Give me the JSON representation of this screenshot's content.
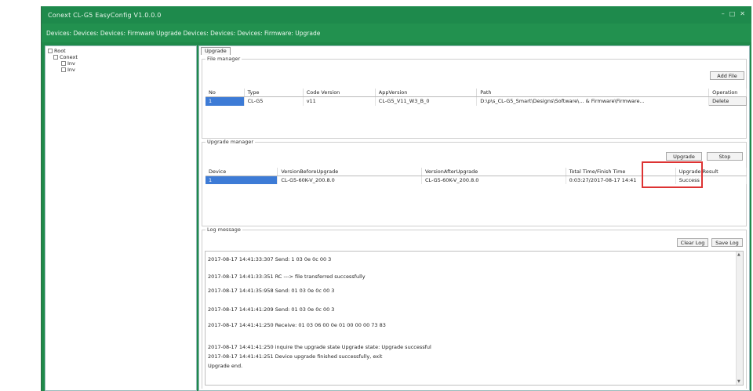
{
  "window": {
    "title": "Conext CL-G5 EasyConfig V1.0.0.0",
    "controls": [
      "–",
      "□",
      "✕"
    ]
  },
  "devices_bar": "Devices: Devices: Devices: Firmware Upgrade Devices: Devices: Devices: Firmware: Upgrade",
  "tree": {
    "root": "Root",
    "child": "Conext",
    "leaves": [
      "Inv",
      "Inv"
    ]
  },
  "tab": "Upgrade",
  "file_manager": {
    "title": "File manager",
    "add_button": "Add File",
    "columns": [
      "No",
      "Type",
      "Code Version",
      "AppVersion",
      "Path",
      "Operation"
    ],
    "rows": [
      {
        "no": "1",
        "type": "CL-G5",
        "code": "v11",
        "app": "CL-G5_V11_W3_B_0",
        "path": "D:\\p\\s_CL-G5_Smart\\Designs\\Software\\... & Firmware\\Firmware...",
        "op": "Delete"
      }
    ]
  },
  "upgrade_manager": {
    "title": "Upgrade manager",
    "upgrade_button": "Upgrade",
    "stop_button": "Stop",
    "columns": [
      "Device",
      "VersionBeforeUpgrade",
      "VersionAfterUpgrade",
      "Total Time/Finish Time",
      "Upgrade Result"
    ],
    "rows": [
      {
        "device": "1",
        "before": "CL-G5-60K-V_200.8.0",
        "after": "CL-G5-60K-V_200.8.0",
        "time": "0:03:27/2017-08-17 14:41",
        "result": "Success"
      }
    ]
  },
  "log": {
    "title": "Log message",
    "clear_button": "Clear Log",
    "save_button": "Save Log",
    "lines": [
      "2017-08-17 14:41:33:307 Send: 1 03 0e 0c 00 3",
      "2017-08-17 14:41:33:351 RC ---> file transferred successfully",
      "2017-08-17 14:41:35:958 Send: 01 03 0e 0c 00 3",
      "2017-08-17 14:41:41:209 Send: 01 03 0e 0c 00 3",
      "2017-08-17 14:41:41:250 Receive: 01 03 06 00 0e 01 00 00 00 73 83",
      "2017-08-17 14:41:41:250 inquire the upgrade state Upgrade state: Upgrade successful",
      "2017-08-17 14:41:41:251 Device upgrade finished successfully, exit",
      "Upgrade end."
    ]
  }
}
